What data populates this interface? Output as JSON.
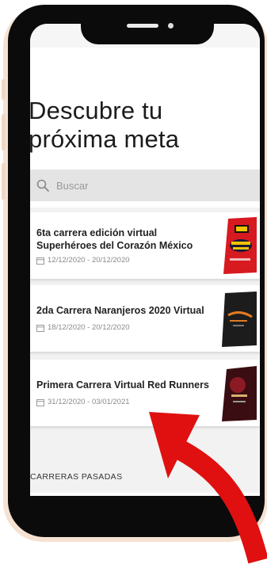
{
  "header": {
    "title_line1": "Descubre tu",
    "title_line2": "próxima meta"
  },
  "search": {
    "placeholder": "Buscar",
    "icon": "search-icon"
  },
  "events": [
    {
      "title": "6ta carrera edición virtual Superhéroes del Corazón México",
      "dates": "12/12/2020 - 20/12/2020"
    },
    {
      "title": "2da Carrera Naranjeros 2020 Virtual",
      "dates": "18/12/2020 - 20/12/2020"
    },
    {
      "title": "Primera Carrera Virtual Red Runners",
      "dates": "31/12/2020 - 03/01/2021"
    }
  ],
  "past_section": {
    "label": "CARRERAS PASADAS"
  },
  "colors": {
    "accent_arrow": "#e01010",
    "phone_frame": "#0b0b0b",
    "search_bg": "#e4e4e4"
  }
}
